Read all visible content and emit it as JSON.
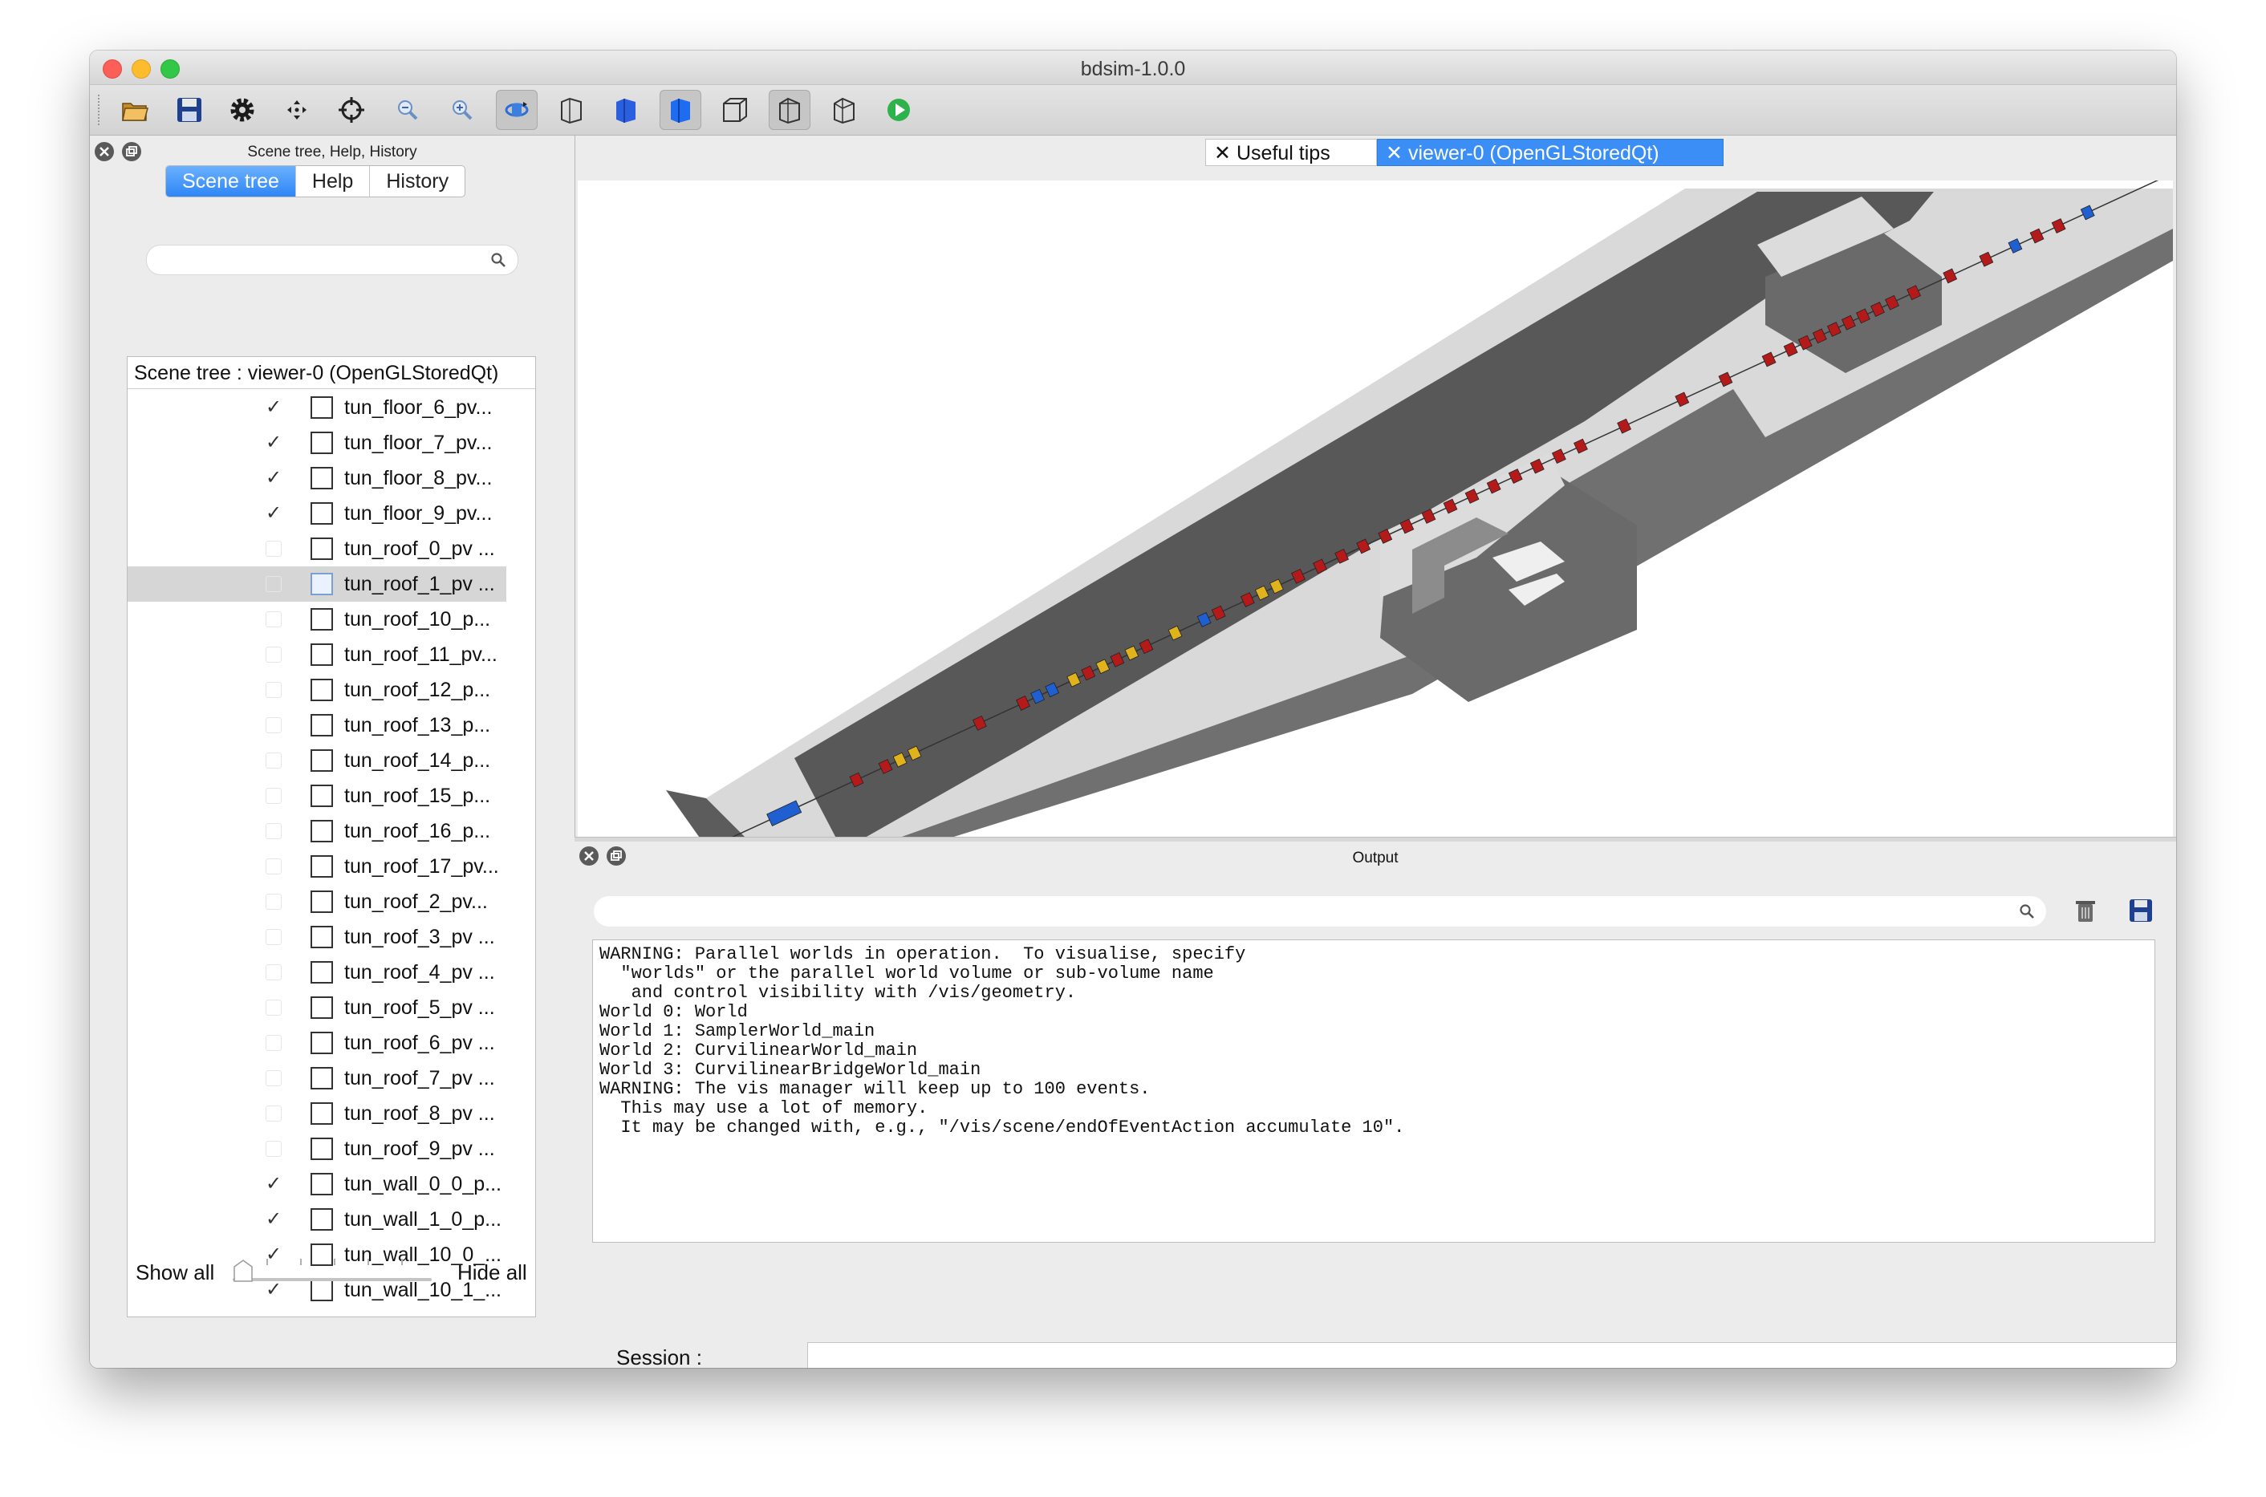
{
  "window": {
    "title": "bdsim-1.0.0"
  },
  "toolbar": {
    "buttons": [
      {
        "icon": "open-folder-icon"
      },
      {
        "icon": "save-icon"
      },
      {
        "icon": "settings-gear-icon"
      },
      {
        "icon": "move-icon"
      },
      {
        "icon": "crosshair-icon"
      },
      {
        "icon": "zoom-out-icon"
      },
      {
        "icon": "zoom-in-icon"
      },
      {
        "icon": "rotate-icon",
        "active": true
      },
      {
        "icon": "wireframe-view-icon"
      },
      {
        "icon": "hidden-line-view-icon"
      },
      {
        "icon": "solid-view-icon",
        "active": true
      },
      {
        "icon": "perspective-icon"
      },
      {
        "icon": "ortho-icon",
        "active": true
      },
      {
        "icon": "reset-view-icon"
      },
      {
        "icon": "run-icon"
      }
    ]
  },
  "scene_dock": {
    "title": "Scene tree, Help, History",
    "tabs": [
      "Scene tree",
      "Help",
      "History"
    ],
    "active_tab": "Scene tree",
    "search_placeholder": "",
    "tree_header": "Scene tree : viewer-0 (OpenGLStoredQt)",
    "rows": [
      {
        "label": "tun_floor_6_pv...",
        "checked": true
      },
      {
        "label": "tun_floor_7_pv...",
        "checked": true
      },
      {
        "label": "tun_floor_8_pv...",
        "checked": true
      },
      {
        "label": "tun_floor_9_pv...",
        "checked": true
      },
      {
        "label": "tun_roof_0_pv ...",
        "checked": false
      },
      {
        "label": "tun_roof_1_pv ...",
        "checked": false,
        "selected": true
      },
      {
        "label": "tun_roof_10_p...",
        "checked": false
      },
      {
        "label": "tun_roof_11_pv...",
        "checked": false
      },
      {
        "label": "tun_roof_12_p...",
        "checked": false
      },
      {
        "label": "tun_roof_13_p...",
        "checked": false
      },
      {
        "label": "tun_roof_14_p...",
        "checked": false
      },
      {
        "label": "tun_roof_15_p...",
        "checked": false
      },
      {
        "label": "tun_roof_16_p...",
        "checked": false
      },
      {
        "label": "tun_roof_17_pv...",
        "checked": false
      },
      {
        "label": "tun_roof_2_pv...",
        "checked": false
      },
      {
        "label": "tun_roof_3_pv ...",
        "checked": false
      },
      {
        "label": "tun_roof_4_pv ...",
        "checked": false
      },
      {
        "label": "tun_roof_5_pv ...",
        "checked": false
      },
      {
        "label": "tun_roof_6_pv ...",
        "checked": false
      },
      {
        "label": "tun_roof_7_pv ...",
        "checked": false
      },
      {
        "label": "tun_roof_8_pv ...",
        "checked": false
      },
      {
        "label": "tun_roof_9_pv ...",
        "checked": false
      },
      {
        "label": "tun_wall_0_0_p...",
        "checked": true
      },
      {
        "label": "tun_wall_1_0_p...",
        "checked": true
      },
      {
        "label": "tun_wall_10_0_...",
        "checked": true
      },
      {
        "label": "tun_wall_10_1_...",
        "checked": true
      }
    ],
    "show_all_label": "Show all",
    "hide_all_label": "Hide all",
    "visibility_slider": 0
  },
  "viewer_tabs": {
    "tips_label": "Useful tips",
    "viewer_label": "viewer-0 (OpenGLStoredQt)",
    "active": "viewer-0 (OpenGLStoredQt)"
  },
  "output_dock": {
    "title": "Output",
    "filter_placeholder": "",
    "lines": [
      "WARNING: Parallel worlds in operation.  To visualise, specify",
      "  \"worlds\" or the parallel world volume or sub-volume name",
      "   and control visibility with /vis/geometry.",
      "World 0: World",
      "World 1: SamplerWorld_main",
      "World 2: CurvilinearWorld_main",
      "World 3: CurvilinearBridgeWorld_main",
      "WARNING: The vis manager will keep up to 100 events.",
      "  This may use a lot of memory.",
      "  It may be changed with, e.g., \"/vis/scene/endOfEventAction accumulate 10\"."
    ],
    "session_label": "Session :",
    "session_value": ""
  },
  "colors": {
    "accent": "#3a8ef5",
    "tunnel_side": "#6d6d6d",
    "tunnel_top": "#d9d9d9",
    "tunnel_inner": "#555555",
    "magnet_red": "#b51a1a",
    "magnet_blue": "#1f5fd0",
    "magnet_yellow": "#e0b21c"
  }
}
